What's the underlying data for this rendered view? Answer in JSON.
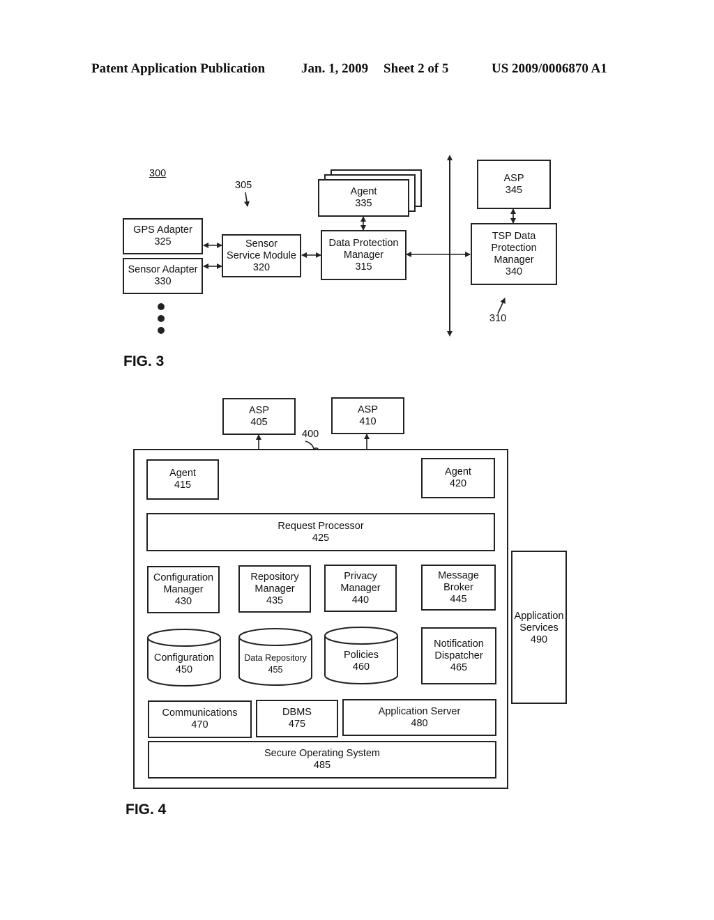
{
  "header": {
    "publication": "Patent Application Publication",
    "date": "Jan. 1, 2009",
    "sheet": "Sheet 2 of 5",
    "number": "US 2009/0006870 A1"
  },
  "fig3": {
    "caption": "FIG. 3",
    "ref_system": "300",
    "ref_client": "305",
    "ref_server": "310",
    "gps_adapter": {
      "name": "GPS Adapter",
      "num": "325"
    },
    "sensor_adapter": {
      "name": "Sensor Adapter",
      "num": "330"
    },
    "sensor_service": {
      "line1": "Sensor",
      "line2": "Service Module",
      "num": "320"
    },
    "agent": {
      "name": "Agent",
      "num": "335"
    },
    "dpm": {
      "line1": "Data Protection",
      "line2": "Manager",
      "num": "315"
    },
    "asp": {
      "name": "ASP",
      "num": "345"
    },
    "tsp": {
      "line1": "TSP Data",
      "line2": "Protection",
      "line3": "Manager",
      "num": "340"
    }
  },
  "fig4": {
    "caption": "FIG. 4",
    "ref_system": "400",
    "asp405": {
      "name": "ASP",
      "num": "405"
    },
    "asp410": {
      "name": "ASP",
      "num": "410"
    },
    "agent415": {
      "name": "Agent",
      "num": "415"
    },
    "agent420": {
      "name": "Agent",
      "num": "420"
    },
    "request_processor": {
      "name": "Request Processor",
      "num": "425"
    },
    "config_manager": {
      "line1": "Configuration",
      "line2": "Manager",
      "num": "430"
    },
    "repo_manager": {
      "line1": "Repository",
      "line2": "Manager",
      "num": "435"
    },
    "privacy_manager": {
      "line1": "Privacy",
      "line2": "Manager",
      "num": "440"
    },
    "message_broker": {
      "line1": "Message",
      "line2": "Broker",
      "num": "445"
    },
    "configuration_db": {
      "name": "Configuration",
      "num": "450"
    },
    "data_repository_db": {
      "name": "Data Repository",
      "num": "455"
    },
    "policies_db": {
      "name": "Policies",
      "num": "460"
    },
    "notification_dispatcher": {
      "line1": "Notification",
      "line2": "Dispatcher",
      "num": "465"
    },
    "communications": {
      "name": "Communications",
      "num": "470"
    },
    "dbms": {
      "name": "DBMS",
      "num": "475"
    },
    "app_server": {
      "name": "Application Server",
      "num": "480"
    },
    "secure_os": {
      "name": "Secure Operating System",
      "num": "485"
    },
    "app_services": {
      "line1": "Application",
      "line2": "Services",
      "num": "490"
    }
  }
}
